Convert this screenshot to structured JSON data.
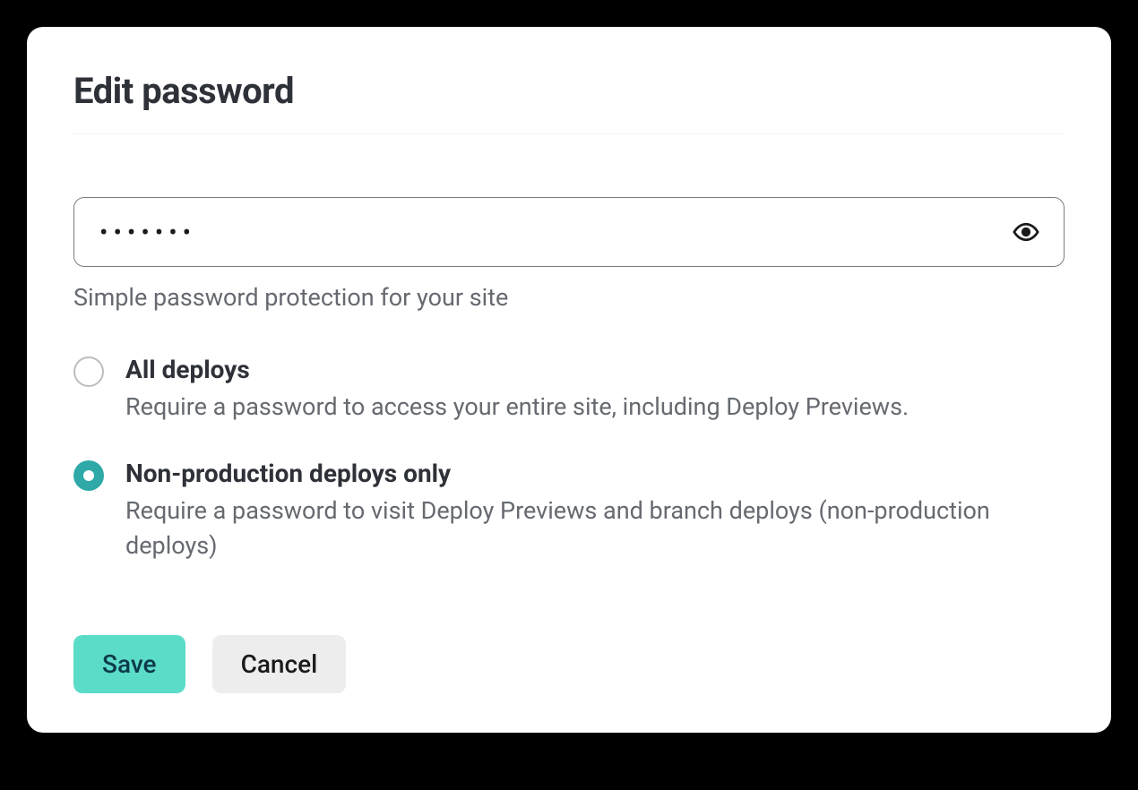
{
  "title": "Edit password",
  "password": {
    "value": "•••••••",
    "help_text": "Simple password protection for your site"
  },
  "options": [
    {
      "label": "All deploys",
      "description": "Require a password to access your entire site, including Deploy Previews.",
      "selected": false
    },
    {
      "label": "Non-production deploys only",
      "description": "Require a password to visit Deploy Previews and branch deploys (non-production deploys)",
      "selected": true
    }
  ],
  "buttons": {
    "save": "Save",
    "cancel": "Cancel"
  }
}
